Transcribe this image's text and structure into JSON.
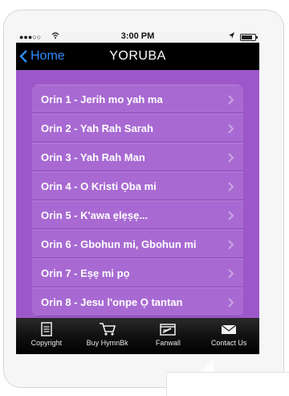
{
  "status_bar": {
    "signal": "●●●○○",
    "time": "3:00 PM"
  },
  "nav": {
    "back_label": "Home",
    "title": "YORUBA"
  },
  "songs": [
    "Orin 1 - Jerih mo yah ma",
    "Orin 2 - Yah Rah Sarah",
    "Orin 3 - Yah Rah Man",
    "Orin 4 - O Kristi Ọba mi",
    "Orin 5 - K'awa ẹlẹṣẹ...",
    "Orin 6 - Gbohun mi, Gbohun mi",
    "Orin 7 - Eṣẹ mi pọ",
    "Orin 8 - Jesu l'onpe Ọ tantan"
  ],
  "tabs": [
    {
      "label": "Copyright",
      "icon": "document-icon"
    },
    {
      "label": "Buy HymnBk",
      "icon": "cart-icon"
    },
    {
      "label": "Fanwall",
      "icon": "notepad-icon"
    },
    {
      "label": "Contact Us",
      "icon": "envelope-icon"
    }
  ],
  "colors": {
    "background": "#9c58c8",
    "row": "#a86ad2",
    "back_link": "#2d8cff"
  }
}
